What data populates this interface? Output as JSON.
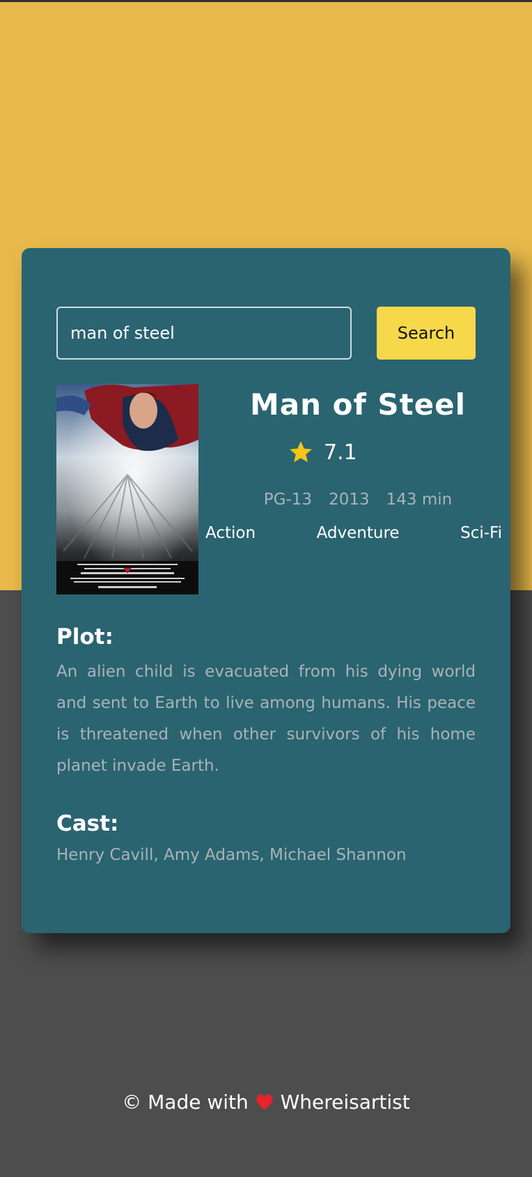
{
  "search": {
    "value": "man of steel",
    "button_label": "Search"
  },
  "movie": {
    "title": "Man of Steel",
    "rating": "7.1",
    "rated": "PG-13",
    "year": "2013",
    "runtime": "143 min",
    "genres": [
      "Action",
      "Adventure",
      "Sci-Fi"
    ],
    "plot_heading": "Plot:",
    "plot": "An alien child is evacuated from his dying world and sent to Earth to live among humans. His peace is threatened when other survivors of his home planet invade Earth.",
    "cast_heading": "Cast:",
    "cast": "Henry Cavill, Amy Adams, Michael Shannon",
    "poster_icon": "movie-poster-image"
  },
  "footer": {
    "prefix": "© Made with",
    "heart_icon": "heart-icon",
    "author": "Whereisartist"
  },
  "colors": {
    "top_background": "#e8b94a",
    "bottom_background": "#4d4d4d",
    "card": "#2a6470",
    "button": "#f6d84a",
    "star": "#f5c518",
    "muted_text": "#a8b4b8"
  }
}
